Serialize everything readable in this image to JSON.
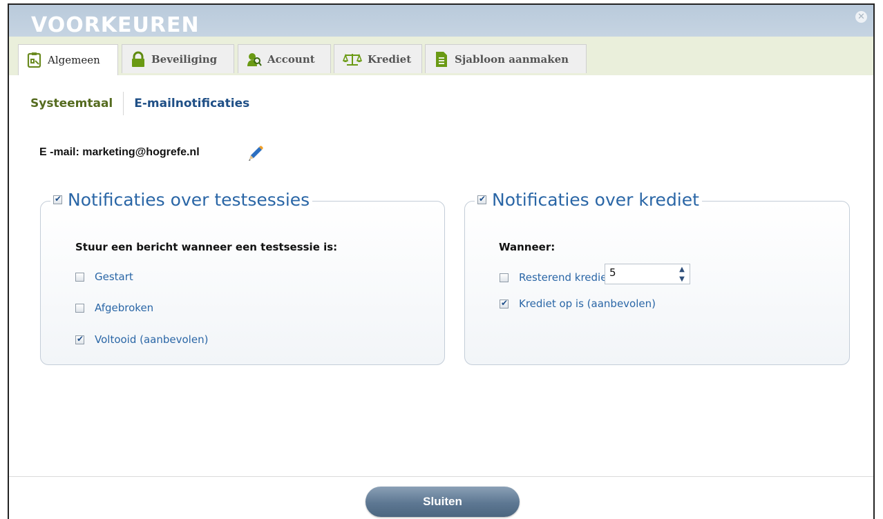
{
  "dialog": {
    "title": "VOORKEUREN",
    "close_icon": "close-icon"
  },
  "tabs": [
    {
      "label": "Algemeen",
      "icon": "clipboard-icon",
      "active": true
    },
    {
      "label": "Beveiliging",
      "icon": "lock-icon",
      "active": false
    },
    {
      "label": "Account",
      "icon": "user-search-icon",
      "active": false
    },
    {
      "label": "Krediet",
      "icon": "scale-icon",
      "active": false
    },
    {
      "label": "Sjabloon aanmaken",
      "icon": "document-icon",
      "active": false
    }
  ],
  "subnav": {
    "systeemtaal": "Systeemtaal",
    "emailnotificaties": "E-mailnotificaties"
  },
  "email": {
    "text": "E -mail: marketing@hogrefe.nl",
    "edit_icon": "pencil-icon"
  },
  "panel_tests": {
    "legend": "Notificaties over testsessies",
    "legend_checked": true,
    "heading": "Stuur een bericht wanneer een testsessie is:",
    "options": [
      {
        "label": "Gestart",
        "checked": false
      },
      {
        "label": "Afgebroken",
        "checked": false
      },
      {
        "label": "Voltooid (aanbevolen)",
        "checked": true
      }
    ]
  },
  "panel_credit": {
    "legend": "Notificaties over krediet",
    "legend_checked": true,
    "heading": "Wanneer:",
    "remaining": {
      "label": "Resterend krediet is",
      "checked": false,
      "value": "5"
    },
    "empty": {
      "label": "Krediet op is (aanbevolen)",
      "checked": true
    }
  },
  "footer": {
    "close_label": "Sluiten"
  },
  "colors": {
    "accent_blue": "#2a66a6",
    "olive": "#556b1f",
    "tabbar_bg": "#eaefdb",
    "titlebar_bg": "#bfcede"
  }
}
